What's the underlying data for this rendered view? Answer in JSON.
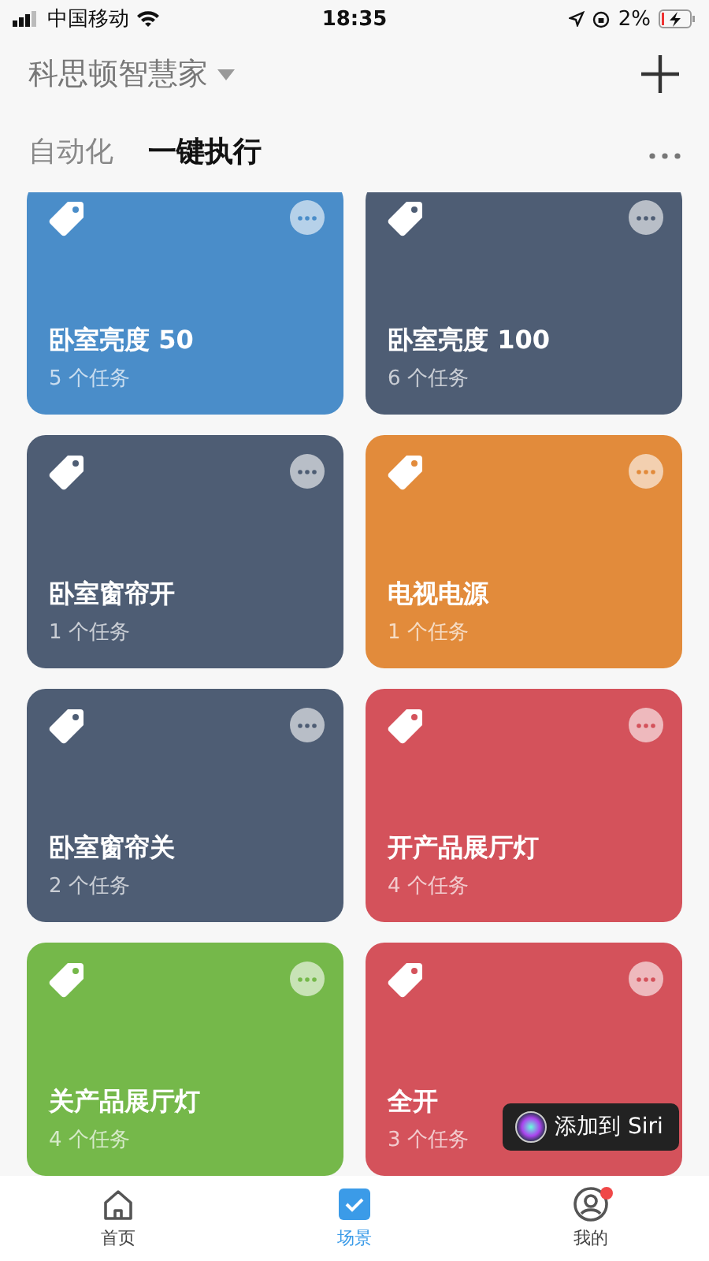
{
  "status_bar": {
    "carrier": "中国移动",
    "time": "18:35",
    "battery": "2%"
  },
  "header": {
    "title": "科思顿智慧家"
  },
  "tabs": [
    {
      "label": "自动化",
      "selected": false
    },
    {
      "label": "一键执行",
      "selected": true
    }
  ],
  "scenes": [
    {
      "name": "卧室亮度 50",
      "tasks": "5 个任务",
      "color": "#4a8dc9"
    },
    {
      "name": "卧室亮度 100",
      "tasks": "6 个任务",
      "color": "#4e5d74"
    },
    {
      "name": "卧室窗帘开",
      "tasks": "1 个任务",
      "color": "#4e5d74"
    },
    {
      "name": "电视电源",
      "tasks": "1 个任务",
      "color": "#e28b3b"
    },
    {
      "name": "卧室窗帘关",
      "tasks": "2 个任务",
      "color": "#4e5d74"
    },
    {
      "name": "开产品展厅灯",
      "tasks": "4 个任务",
      "color": "#d4525b"
    },
    {
      "name": "关产品展厅灯",
      "tasks": "4 个任务",
      "color": "#75b84a"
    },
    {
      "name": "全开",
      "tasks": "3 个任务",
      "color": "#d4525b"
    }
  ],
  "siri_button": {
    "label": "添加到 Siri"
  },
  "nav": [
    {
      "label": "首页",
      "kind": "home",
      "selected": false,
      "notification": false
    },
    {
      "label": "场景",
      "kind": "scene",
      "selected": true,
      "notification": false
    },
    {
      "label": "我的",
      "kind": "profile",
      "selected": false,
      "notification": true
    }
  ]
}
